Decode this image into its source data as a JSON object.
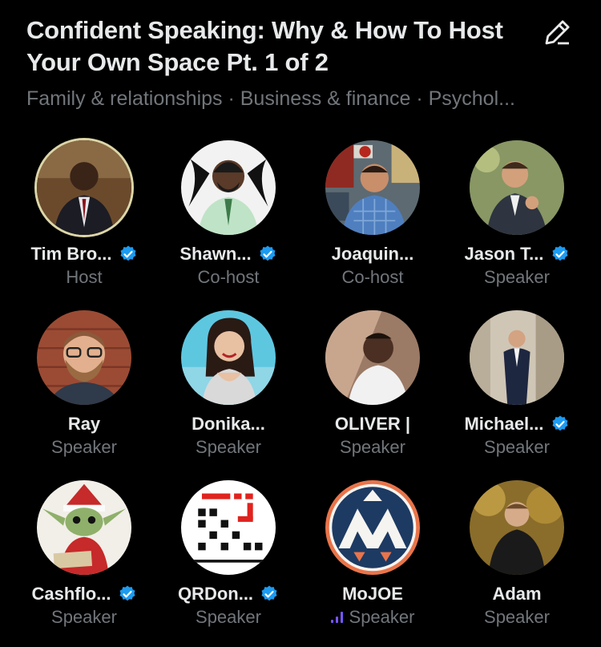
{
  "space": {
    "title": "Confident Speaking: Why & How To Host Your Own Space Pt. 1 of 2",
    "topics": "Family & relationships · Business & finance · Psychol..."
  },
  "participants": [
    {
      "name": "Tim Bro...",
      "role": "Host",
      "verified": true
    },
    {
      "name": "Shawn...",
      "role": "Co-host",
      "verified": true
    },
    {
      "name": "Joaquin...",
      "role": "Co-host",
      "verified": false
    },
    {
      "name": "Jason T...",
      "role": "Speaker",
      "verified": true
    },
    {
      "name": "Ray",
      "role": "Speaker",
      "verified": false
    },
    {
      "name": "Donika...",
      "role": "Speaker",
      "verified": false
    },
    {
      "name": "OLIVER |",
      "role": "Speaker",
      "verified": false
    },
    {
      "name": "Michael...",
      "role": "Speaker",
      "verified": true
    },
    {
      "name": "Cashflo...",
      "role": "Speaker",
      "verified": true
    },
    {
      "name": "QRDon...",
      "role": "Speaker",
      "verified": true
    },
    {
      "name": "MoJOE",
      "role": "Speaker",
      "verified": false
    },
    {
      "name": "Adam",
      "role": "Speaker",
      "verified": false
    }
  ],
  "colors": {
    "background": "#000000",
    "text_primary": "#e7e9ea",
    "text_secondary": "#71767b",
    "verified_blue": "#1d9bf0",
    "speaking_purple": "#7856ff",
    "host_ring": "#dcd6a8"
  },
  "icons": {
    "edit": "pencil-icon",
    "verified": "verified-badge-icon",
    "speaking": "speaking-indicator-icon"
  }
}
